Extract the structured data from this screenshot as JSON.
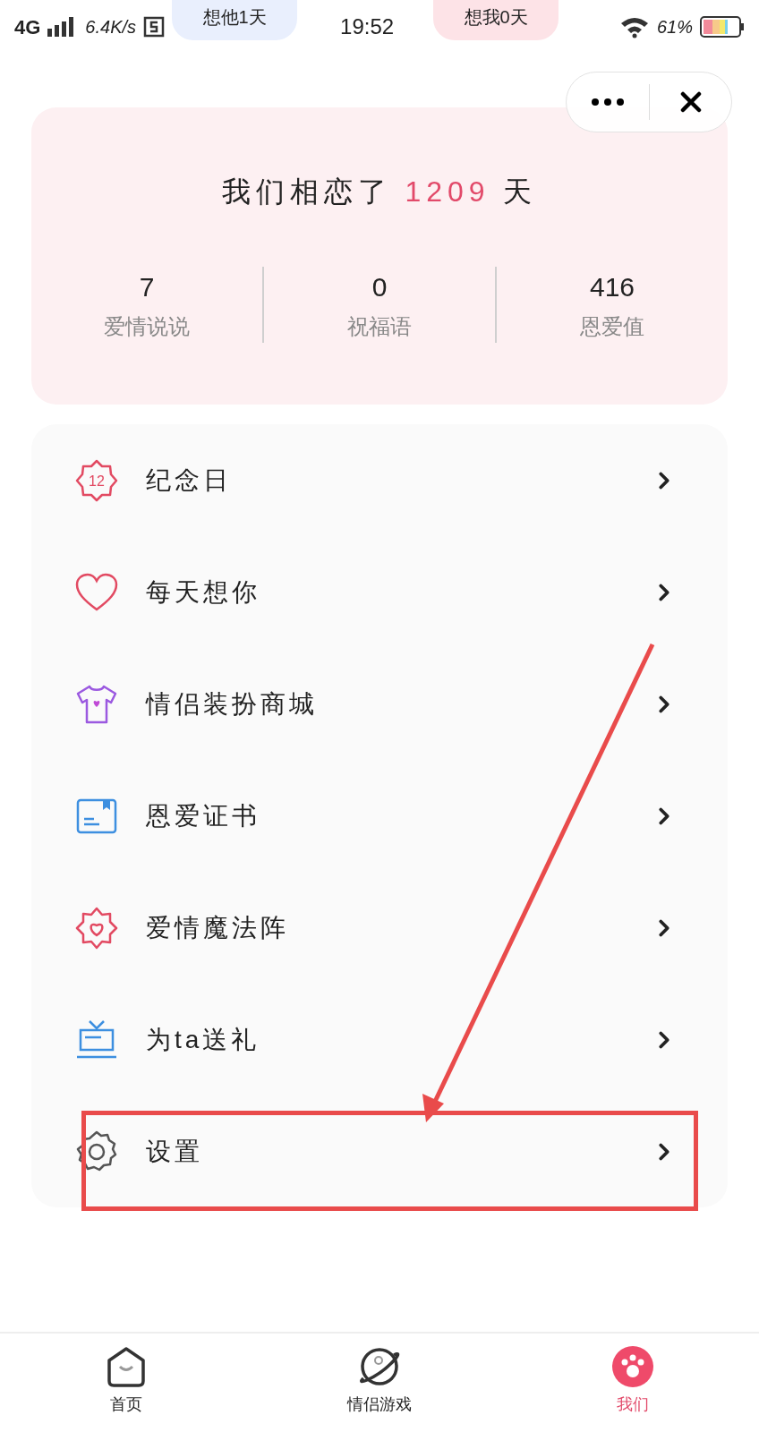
{
  "status_bar": {
    "network": "4G",
    "speed": "6.4K/s",
    "pills": [
      {
        "text": "想他1天",
        "color": "#e9effd"
      },
      {
        "text": "想我0天",
        "color": "#fde3e7"
      }
    ],
    "time": "19:52",
    "battery": "61%"
  },
  "header": {
    "title_before": "我们相恋了",
    "days": "1209",
    "title_after": "天",
    "stats": [
      {
        "value": "7",
        "label": "爱情说说"
      },
      {
        "value": "0",
        "label": "祝福语"
      },
      {
        "value": "416",
        "label": "恩爱值"
      }
    ]
  },
  "menu": [
    {
      "label": "纪念日",
      "badge": "12",
      "highlighted": false
    },
    {
      "label": "每天想你",
      "highlighted": false
    },
    {
      "label": "情侣装扮商城",
      "highlighted": false
    },
    {
      "label": "恩爱证书",
      "highlighted": false
    },
    {
      "label": "爱情魔法阵",
      "highlighted": false
    },
    {
      "label": "为ta送礼",
      "highlighted": false
    },
    {
      "label": "设置",
      "highlighted": true
    }
  ],
  "tab_bar": [
    {
      "label": "首页",
      "selected": false
    },
    {
      "label": "情侣游戏",
      "selected": false
    },
    {
      "label": "我们",
      "selected": true
    }
  ]
}
